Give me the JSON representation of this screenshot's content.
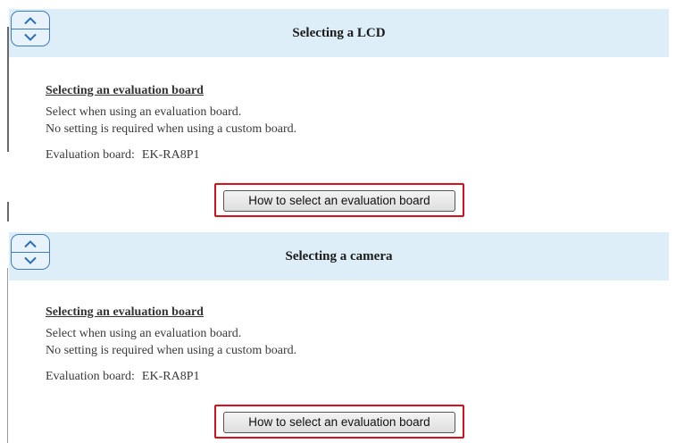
{
  "panels": [
    {
      "header_title": "Selecting a LCD",
      "section_title": "Selecting an evaluation board",
      "desc_line1": "Select when using an evaluation board.",
      "desc_line2": "No setting is required when using a custom board.",
      "eval_label": "Evaluation board:",
      "eval_value": "EK-RA8P1",
      "button_label": "How to select an evaluation board"
    },
    {
      "header_title": "Selecting a camera",
      "section_title": "Selecting an evaluation board",
      "desc_line1": "Select when using an evaluation board.",
      "desc_line2": "No setting is required when using a custom board.",
      "eval_label": "Evaluation board:",
      "eval_value": "EK-RA8P1",
      "button_label": "How to select an evaluation board"
    }
  ],
  "icons": {
    "toggle_up": "chevron-up-icon",
    "toggle_down": "chevron-down-icon"
  },
  "colors": {
    "header_bg": "#ddeef8",
    "toggle_border": "#3b7dc4",
    "highlight_border": "#d8101e"
  }
}
